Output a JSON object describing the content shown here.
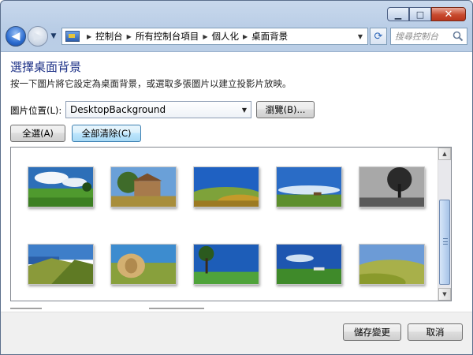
{
  "window": {
    "caption": {
      "minimize_icon": "minimize-icon",
      "maximize_icon": "maximize-icon",
      "close_icon": "close-icon"
    }
  },
  "nav": {
    "breadcrumbs": [
      "控制台",
      "所有控制台項目",
      "個人化",
      "桌面背景"
    ],
    "search_placeholder": "搜尋控制台"
  },
  "page": {
    "title": "選擇桌面背景",
    "description": "按一下圖片將它設定為桌面背景，或選取多張圖片以建立投影片放映。",
    "location_label": "圖片位置(L):",
    "location_value": "DesktopBackground",
    "browse_label": "瀏覽(B)...",
    "select_all_label": "全選(A)",
    "clear_all_label": "全部清除(C)"
  },
  "gallery": {
    "thumbnails": [
      "green-meadow-clouds",
      "stone-farmhouse",
      "golden-hills-blue-sky",
      "prairie-blue-sky",
      "bw-tree",
      "coastal-hills",
      "hay-bale",
      "tree-on-green-field",
      "farm-valley-blue-sky",
      "rolling-golden-hills"
    ]
  },
  "footer": {
    "save_label": "儲存變更",
    "cancel_label": "取消"
  }
}
